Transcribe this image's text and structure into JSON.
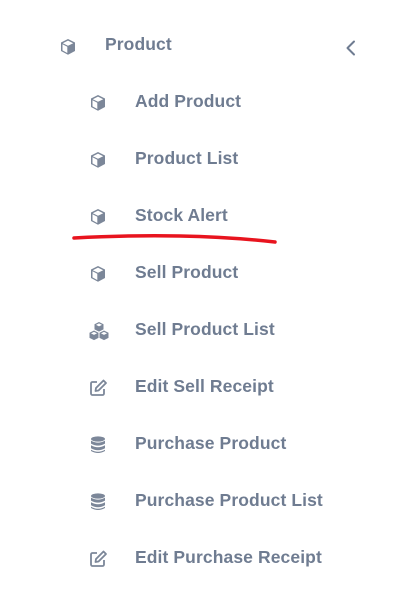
{
  "menu": {
    "parent": {
      "label": "Product",
      "icon": "cube-icon",
      "expanded": true,
      "toggle_icon": "chevron-left-icon"
    },
    "items": [
      {
        "label": "Add Product",
        "icon": "cube-icon"
      },
      {
        "label": "Product List",
        "icon": "cube-icon"
      },
      {
        "label": "Stock Alert",
        "icon": "cube-icon",
        "annotated": true
      },
      {
        "label": "Sell Product",
        "icon": "cube-icon"
      },
      {
        "label": "Sell Product List",
        "icon": "cubes-icon"
      },
      {
        "label": "Edit Sell Receipt",
        "icon": "edit-icon"
      },
      {
        "label": "Purchase Product",
        "icon": "database-icon"
      },
      {
        "label": "Purchase Product List",
        "icon": "database-icon"
      },
      {
        "label": "Edit Purchase Receipt",
        "icon": "edit-icon"
      }
    ]
  },
  "colors": {
    "text": "#6f7c91",
    "icon": "#7c8799",
    "annotation": "#e8141e",
    "background": "#ffffff"
  }
}
